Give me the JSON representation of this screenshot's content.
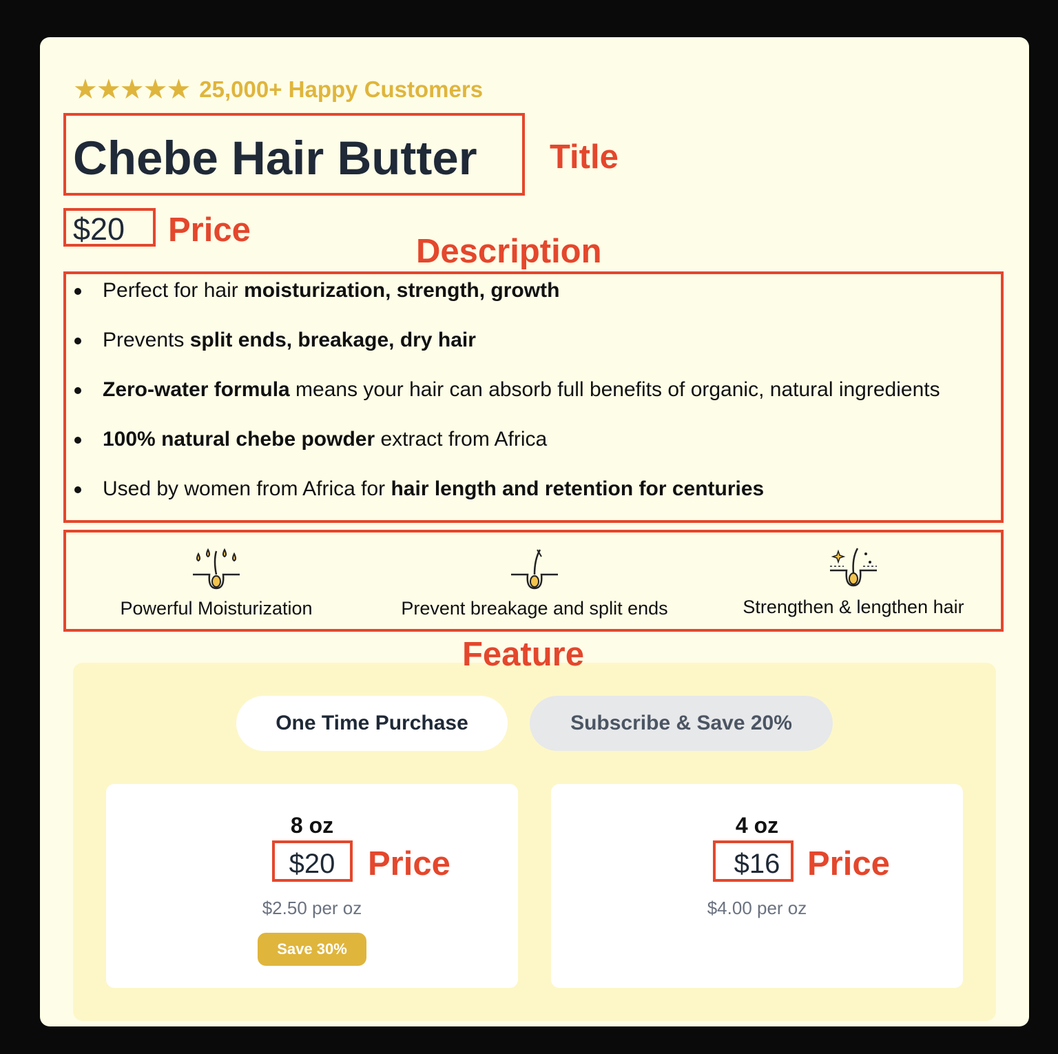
{
  "header": {
    "stars": "★★★★★",
    "customers": "25,000+ Happy Customers"
  },
  "product": {
    "title": "Chebe Hair Butter",
    "price": "$20"
  },
  "description": [
    {
      "pre": "Perfect for hair ",
      "bold": "moisturization, strength, growth",
      "post": ""
    },
    {
      "pre": "Prevents ",
      "bold": "split ends, breakage, dry hair",
      "post": ""
    },
    {
      "pre": "",
      "bold": "Zero-water formula",
      "post": " means your hair can absorb full benefits of organic, natural ingredients"
    },
    {
      "pre": "",
      "bold": "100% natural chebe powder",
      "post": " extract from Africa"
    },
    {
      "pre": "Used by women from Africa for ",
      "bold": "hair length and retention for centuries",
      "post": ""
    }
  ],
  "features": [
    {
      "label": "Powerful Moisturization",
      "icon": "hair-drops-icon"
    },
    {
      "label": "Prevent breakage and split ends",
      "icon": "hair-strand-icon"
    },
    {
      "label": "Strengthen & lengthen hair",
      "icon": "hair-sparkle-icon"
    }
  ],
  "purchase": {
    "tabs": [
      "One Time Purchase",
      "Subscribe & Save 20%"
    ],
    "options": [
      {
        "size": "8 oz",
        "price": "$20",
        "per_oz": "$2.50 per oz",
        "badge": "Save 30%"
      },
      {
        "size": "4 oz",
        "price": "$16",
        "per_oz": "$4.00 per oz"
      }
    ]
  },
  "annotations": {
    "title": "Title",
    "price": "Price",
    "description": "Description",
    "feature": "Feature"
  },
  "colors": {
    "accent_gold": "#dfb53c",
    "annotation_red": "#e4472c",
    "card_bg": "#fefde8",
    "panel_bg": "#fdf7c8"
  }
}
